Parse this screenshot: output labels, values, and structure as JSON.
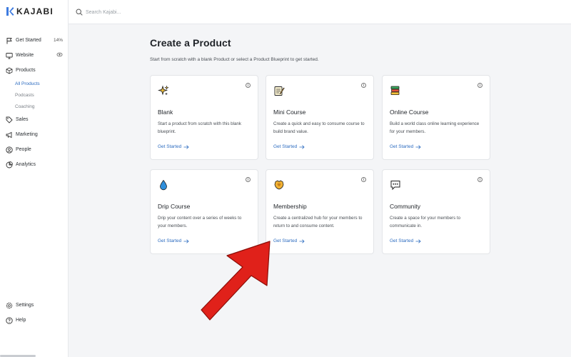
{
  "brand": {
    "name": "KAJABI",
    "accent": "#2d6cc0",
    "arrow_color": "#e0211a"
  },
  "search": {
    "placeholder": "Search Kajabi..."
  },
  "sidebar": {
    "items": [
      {
        "label": "Get Started",
        "icon": "flag-icon",
        "badge": "14%"
      },
      {
        "label": "Website",
        "icon": "monitor-icon",
        "badge_icon": "eye-icon"
      },
      {
        "label": "Products",
        "icon": "box-icon",
        "children": [
          "All Products",
          "Podcasts",
          "Coaching"
        ],
        "active_child": "All Products"
      },
      {
        "label": "Sales",
        "icon": "tag-icon"
      },
      {
        "label": "Marketing",
        "icon": "megaphone-icon"
      },
      {
        "label": "People",
        "icon": "person-icon"
      },
      {
        "label": "Analytics",
        "icon": "chart-icon"
      }
    ],
    "bottom": [
      {
        "label": "Settings",
        "icon": "gear-icon"
      },
      {
        "label": "Help",
        "icon": "help-icon"
      }
    ]
  },
  "main": {
    "title": "Create a Product",
    "subtitle": "Start from scratch with a blank Product or select a Product Blueprint to get started.",
    "cards": [
      {
        "title": "Blank",
        "icon": "sparkle-icon",
        "desc": "Start a product from scratch with this blank blueprint.",
        "cta": "Get Started"
      },
      {
        "title": "Mini Course",
        "icon": "notepad-icon",
        "desc": "Create a quick and easy to consume course to build brand value.",
        "cta": "Get Started"
      },
      {
        "title": "Online Course",
        "icon": "books-icon",
        "desc": "Build a world class online learning experience for your members.",
        "cta": "Get Started"
      },
      {
        "title": "Drip Course",
        "icon": "droplet-icon",
        "desc": "Drip your content over a series of weeks to your members.",
        "cta": "Get Started"
      },
      {
        "title": "Membership",
        "icon": "badge-heart-icon",
        "desc": "Create a centralized hub for your members to return to and consume content.",
        "cta": "Get Started"
      },
      {
        "title": "Community",
        "icon": "chat-bubble-icon",
        "desc": "Create a space for your members to communicate in.",
        "cta": "Get Started"
      }
    ]
  }
}
